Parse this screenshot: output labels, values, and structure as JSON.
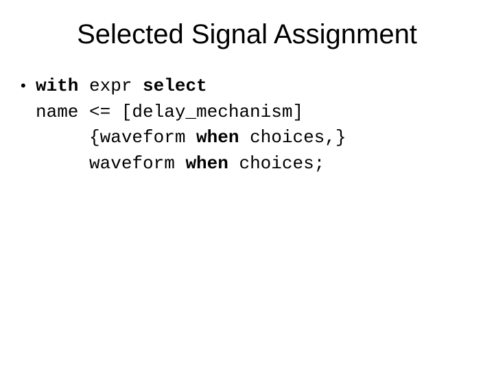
{
  "title": "Selected Signal Assignment",
  "bullet": "•",
  "syntax": {
    "kw_with": "with",
    "expr": " expr ",
    "kw_select": "select",
    "line2": "name <= [delay_mechanism]",
    "line3_pre": "     {waveform ",
    "kw_when1": "when",
    "line3_post": " choices,}",
    "line4_pre": "     waveform ",
    "kw_when2": "when",
    "line4_post": " choices;"
  }
}
